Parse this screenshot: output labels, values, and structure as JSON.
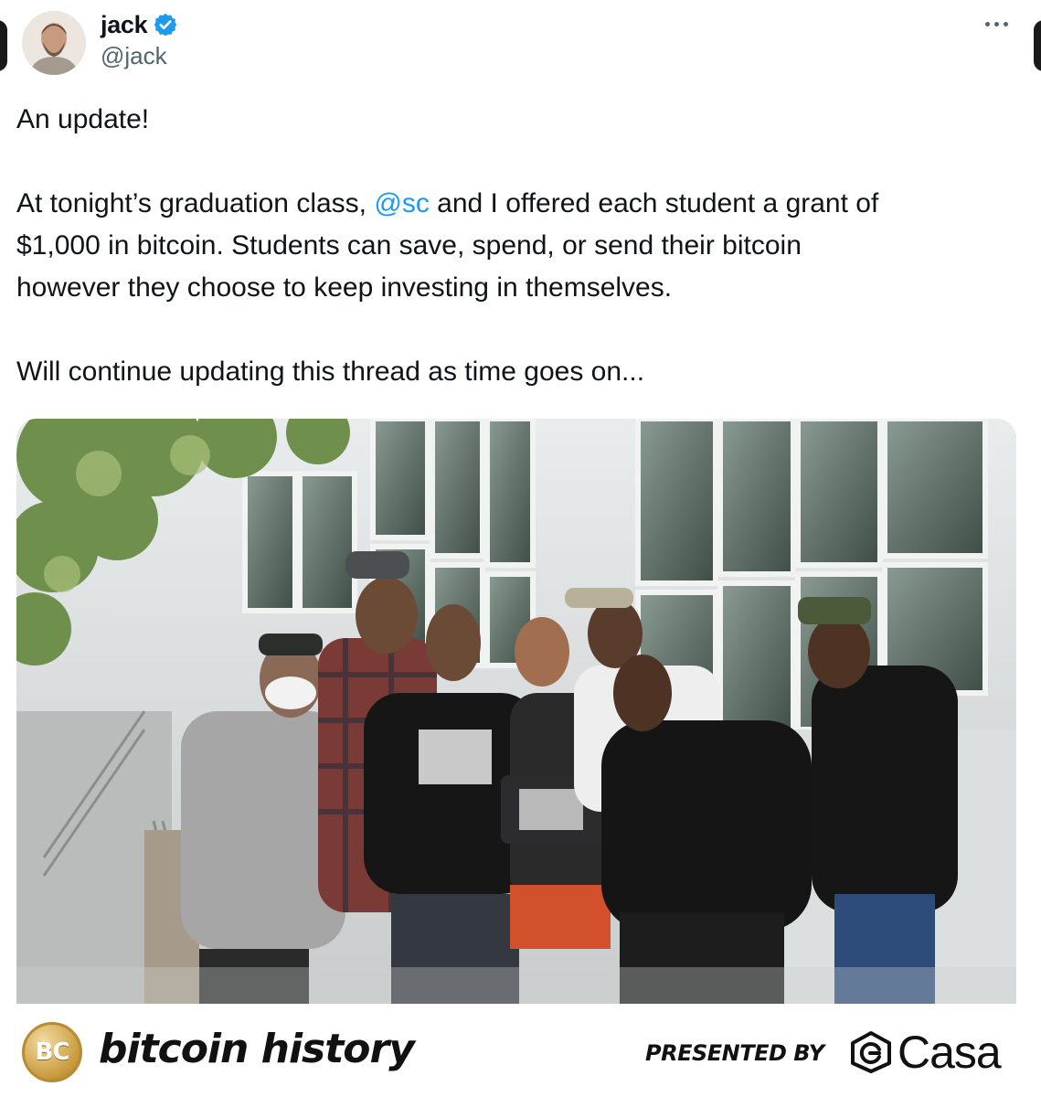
{
  "tweet": {
    "display_name": "jack",
    "handle": "@jack",
    "verified_icon": "verified-badge-icon",
    "more_icon": "more-options-icon",
    "text": {
      "line1": "An update!",
      "p2_before_mention": "At tonight’s graduation class, ",
      "mention": "@sc",
      "p2_line1_after": " and I offered each student a grant of",
      "p2_line2": "$1,000 in bitcoin. Students can save, spend, or send their bitcoin",
      "p2_line3": "however they choose to keep investing in themselves.",
      "p3": "Will continue updating this thread as time goes on..."
    },
    "media_alt": "Group photo of graduates outside a building"
  },
  "footer": {
    "badge_text": "BC",
    "brand_name": "bitcoin history",
    "presented_by": "PRESENTED BY",
    "sponsor": "Casa"
  },
  "colors": {
    "verified": "#1d9bf0",
    "mention": "#1d9bf0",
    "handle": "#536471"
  }
}
